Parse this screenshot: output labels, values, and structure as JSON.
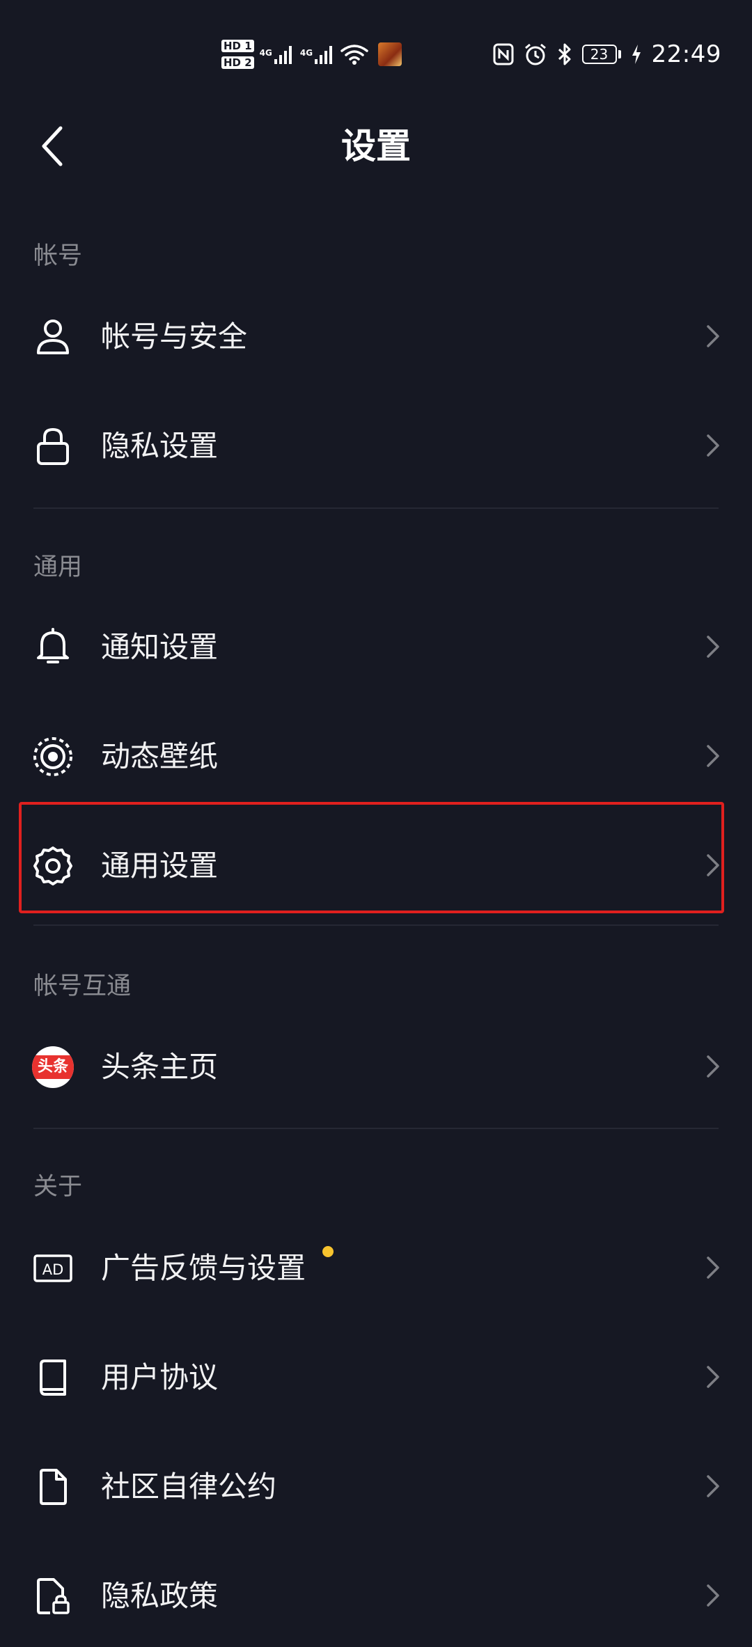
{
  "status_bar": {
    "sim1": "HD 1",
    "sim2": "HD 2",
    "net1": "4G",
    "net2": "4G",
    "battery": "23",
    "time": "22:49"
  },
  "header": {
    "title": "设置"
  },
  "sections": {
    "account": {
      "label": "帐号",
      "items": [
        {
          "label": "帐号与安全",
          "icon": "user-icon"
        },
        {
          "label": "隐私设置",
          "icon": "lock-icon"
        }
      ]
    },
    "general": {
      "label": "通用",
      "items": [
        {
          "label": "通知设置",
          "icon": "bell-icon"
        },
        {
          "label": "动态壁纸",
          "icon": "live-wallpaper-icon"
        },
        {
          "label": "通用设置",
          "icon": "gear-icon"
        }
      ]
    },
    "linked": {
      "label": "帐号互通",
      "items": [
        {
          "label": "头条主页",
          "icon": "toutiao-logo-icon",
          "logo_text": "头条"
        }
      ]
    },
    "about": {
      "label": "关于",
      "items": [
        {
          "label": "广告反馈与设置",
          "icon": "ad-icon",
          "badge_color": "#f7c32e"
        },
        {
          "label": "用户协议",
          "icon": "book-icon"
        },
        {
          "label": "社区自律公约",
          "icon": "document-icon"
        },
        {
          "label": "隐私政策",
          "icon": "privacy-policy-icon"
        }
      ]
    }
  },
  "colors": {
    "background": "#161823",
    "highlight_border": "#e0201e",
    "section_label": "#8a8b91"
  }
}
